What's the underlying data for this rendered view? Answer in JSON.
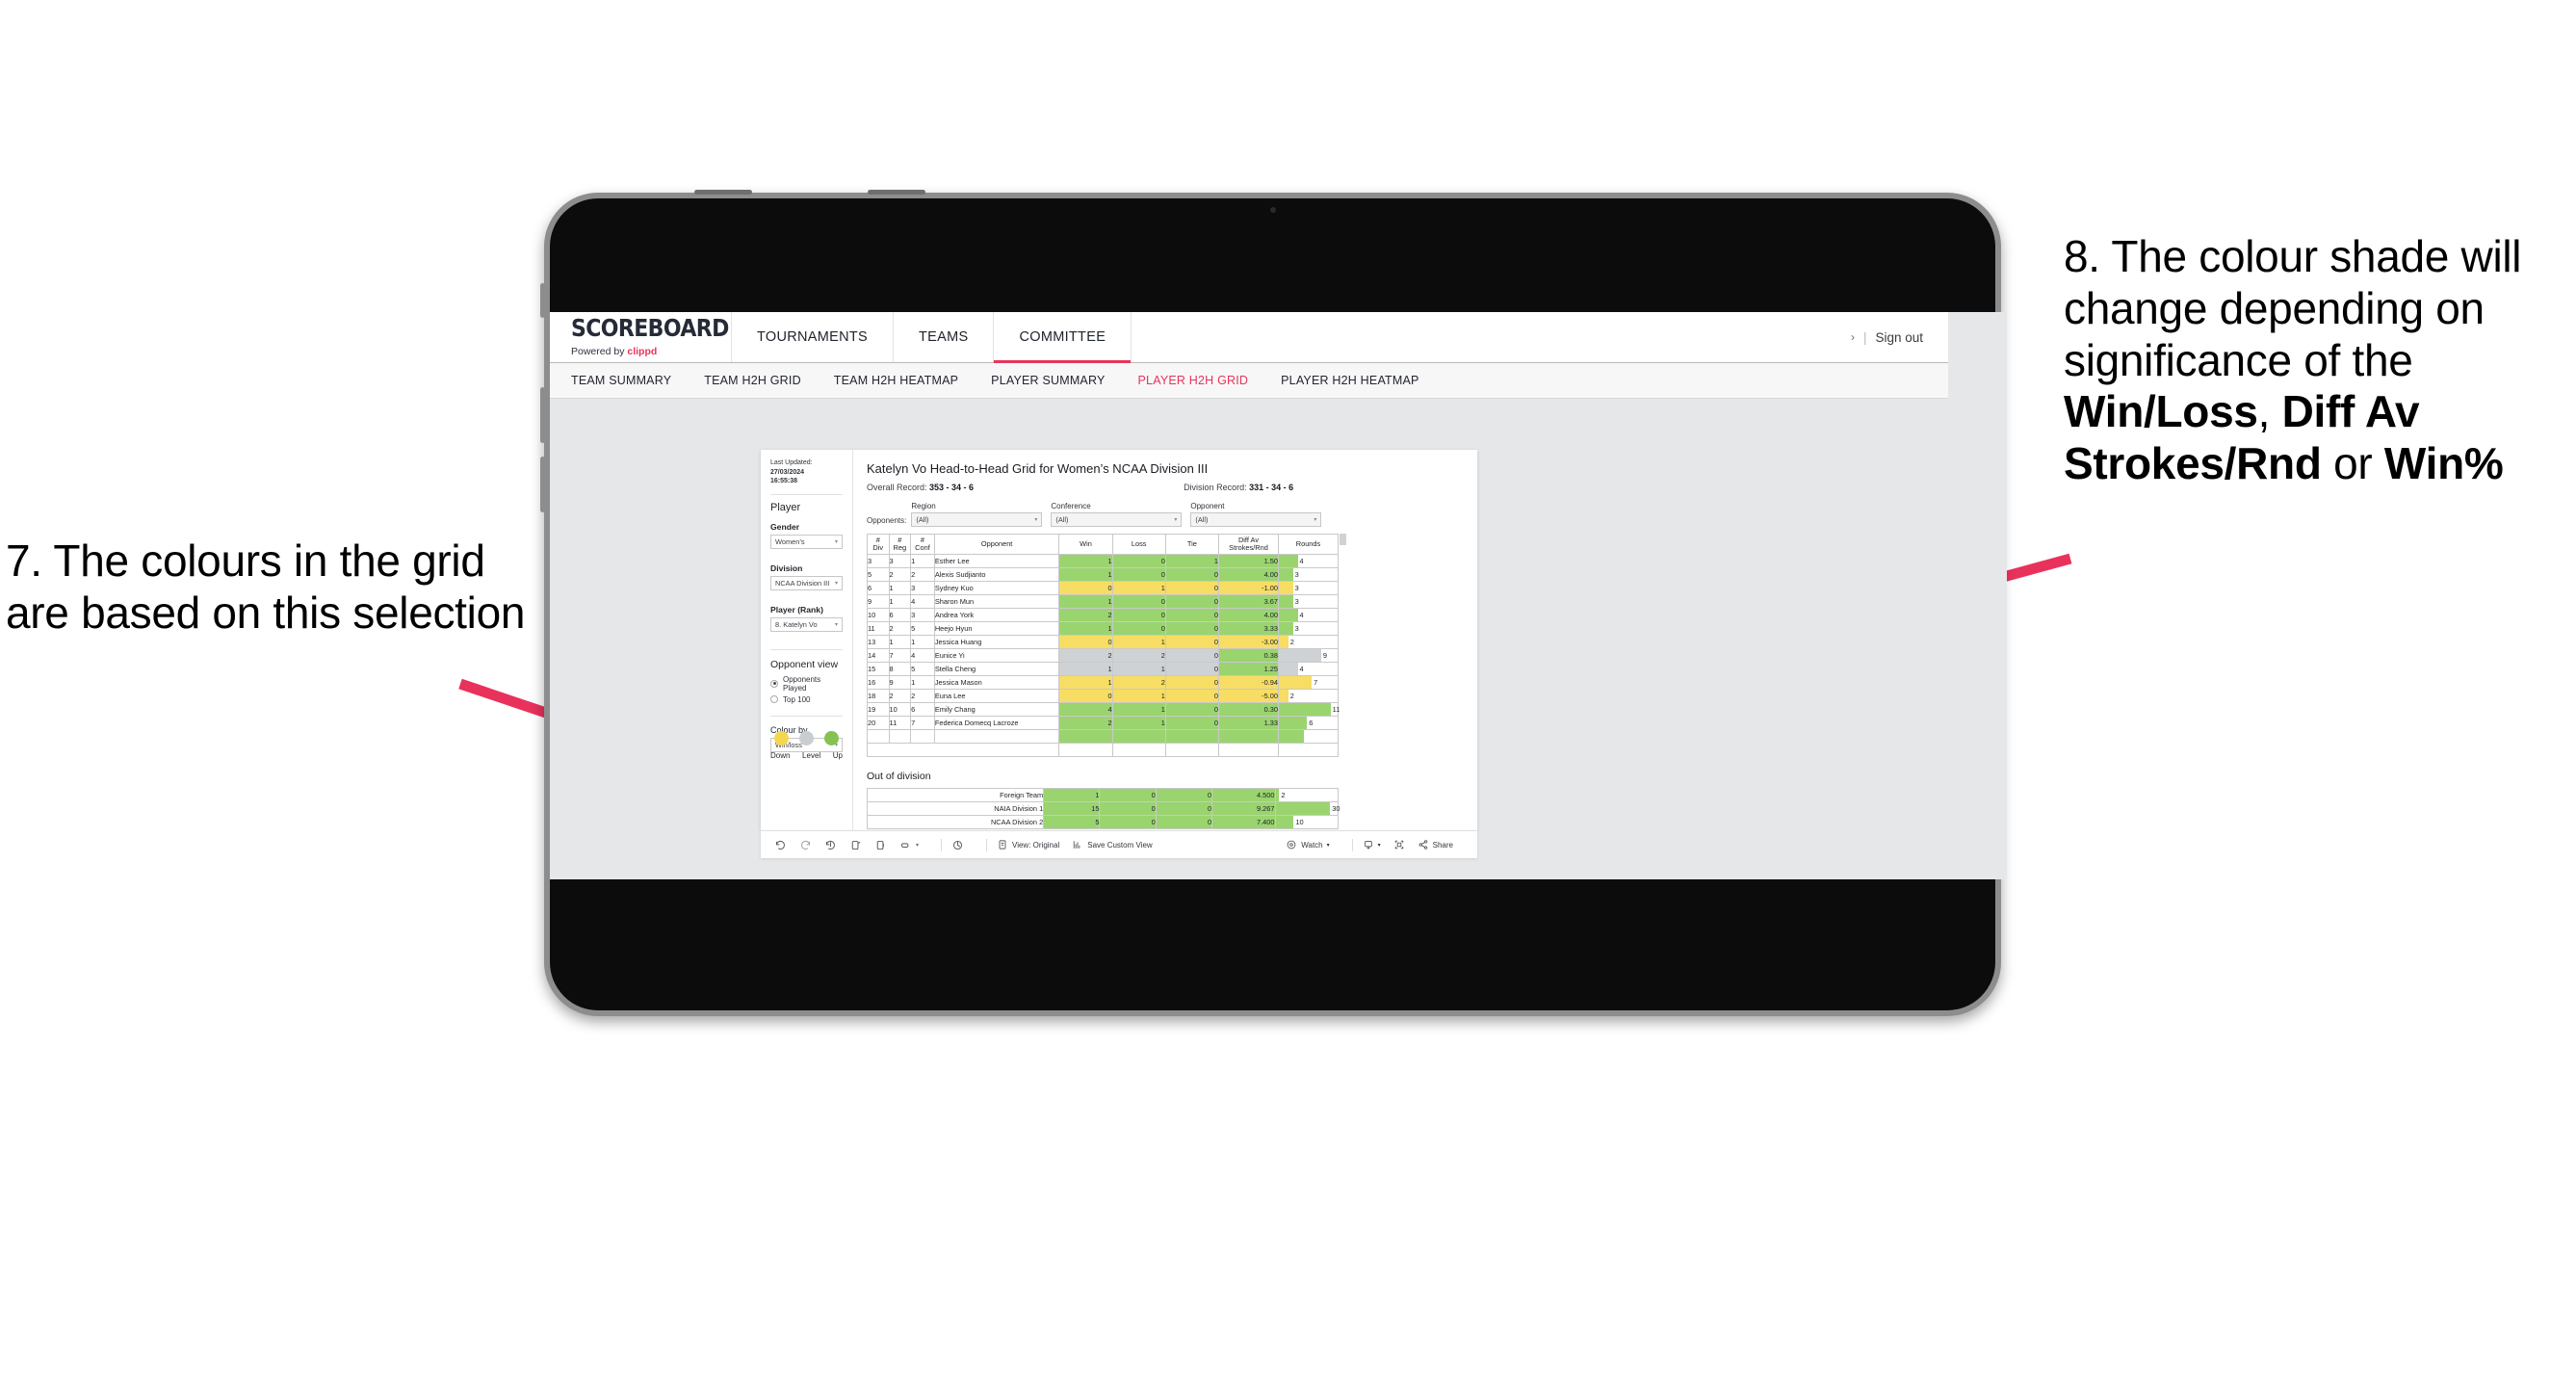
{
  "annotations": {
    "left": {
      "id": "7.",
      "text": "7. The colours in the grid are based on this selection"
    },
    "right": {
      "prefix": "8. The colour shade will change depending on significance of the ",
      "bold1": "Win/Loss",
      "mid1": ", ",
      "bold2": "Diff Av Strokes/Rnd",
      "mid2": " or ",
      "bold3": "Win%"
    },
    "arrow_color": "#e8325c"
  },
  "header": {
    "brand_title": "SCOREBOARD",
    "brand_powered": "Powered by ",
    "brand_name": "clippd",
    "nav": [
      {
        "label": "TOURNAMENTS",
        "active": false
      },
      {
        "label": "TEAMS",
        "active": false
      },
      {
        "label": "COMMITTEE",
        "active": true
      }
    ],
    "chevron": "›",
    "pipe": "|",
    "signout": "Sign out",
    "accent": "#e8345a"
  },
  "subnav": [
    {
      "label": "TEAM SUMMARY",
      "active": false
    },
    {
      "label": "TEAM H2H GRID",
      "active": false
    },
    {
      "label": "TEAM H2H HEATMAP",
      "active": false
    },
    {
      "label": "PLAYER SUMMARY",
      "active": false
    },
    {
      "label": "PLAYER H2H GRID",
      "active": true
    },
    {
      "label": "PLAYER H2H HEATMAP",
      "active": false
    }
  ],
  "sidebar": {
    "last_updated_label": "Last Updated: ",
    "last_updated_date": "27/03/2024",
    "last_updated_time": "16:55:38",
    "player_heading": "Player",
    "gender_label": "Gender",
    "gender_value": "Women’s",
    "division_label": "Division",
    "division_value": "NCAA Division III",
    "player_rank_label": "Player (Rank)",
    "player_rank_value": "8. Katelyn Vo",
    "opponent_view_heading": "Opponent view",
    "opponent_view_options": [
      {
        "label": "Opponents Played",
        "selected": true
      },
      {
        "label": "Top 100",
        "selected": false
      }
    ],
    "colour_by_label": "Colour by",
    "colour_by_value": "Win/loss",
    "legend": [
      {
        "label": "Down",
        "color": "#f3d84e"
      },
      {
        "label": "Level",
        "color": "#c9cdd1"
      },
      {
        "label": "Up",
        "color": "#84c251"
      }
    ]
  },
  "main": {
    "title": "Katelyn Vo Head-to-Head Grid for Women’s NCAA Division III",
    "overall_record_label": "Overall Record: ",
    "overall_record_value": "353 -  34 - 6",
    "division_record_label": "Division Record: ",
    "division_record_value": "331 -  34 - 6",
    "opponents_label": "Opponents:",
    "filters": [
      {
        "label": "Region",
        "value": "(All)"
      },
      {
        "label": "Conference",
        "value": "(All)"
      },
      {
        "label": "Opponent",
        "value": "(All)"
      }
    ],
    "out_of_division_title": "Out of division"
  },
  "chart_data": {
    "type": "table",
    "title": "Katelyn Vo Head-to-Head Grid for Women’s NCAA Division III",
    "columns": [
      "# Div",
      "# Reg",
      "# Conf",
      "Opponent",
      "Win",
      "Loss",
      "Tie",
      "Diff Av Strokes/Rnd",
      "Rounds"
    ],
    "column_headers_lines": [
      [
        "#",
        "Div"
      ],
      [
        "#",
        "Reg"
      ],
      [
        "#",
        "Conf"
      ],
      [
        "Opponent"
      ],
      [
        "Win"
      ],
      [
        "Loss"
      ],
      [
        "Tie"
      ],
      [
        "Diff Av",
        "Strokes/Rnd"
      ],
      [
        "Rounds"
      ]
    ],
    "colors": {
      "up": "#9ad46f",
      "down": "#f7dd63",
      "level": "#cfd2d4",
      "none": "#ffffff"
    },
    "rounds_max": 11,
    "rows": [
      {
        "div": "3",
        "reg": "3",
        "conf": "1",
        "opponent": "Esther Lee",
        "win": "1",
        "loss": "0",
        "tie": "1",
        "diff": "1.50",
        "rounds": 4,
        "state": "up"
      },
      {
        "div": "5",
        "reg": "2",
        "conf": "2",
        "opponent": "Alexis Sudjianto",
        "win": "1",
        "loss": "0",
        "tie": "0",
        "diff": "4.00",
        "rounds": 3,
        "state": "up"
      },
      {
        "div": "6",
        "reg": "1",
        "conf": "3",
        "opponent": "Sydney Kuo",
        "win": "0",
        "loss": "1",
        "tie": "0",
        "diff": "-1.00",
        "rounds": 3,
        "state": "down"
      },
      {
        "div": "9",
        "reg": "1",
        "conf": "4",
        "opponent": "Sharon Mun",
        "win": "1",
        "loss": "0",
        "tie": "0",
        "diff": "3.67",
        "rounds": 3,
        "state": "up"
      },
      {
        "div": "10",
        "reg": "6",
        "conf": "3",
        "opponent": "Andrea York",
        "win": "2",
        "loss": "0",
        "tie": "0",
        "diff": "4.00",
        "rounds": 4,
        "state": "up"
      },
      {
        "div": "11",
        "reg": "2",
        "conf": "5",
        "opponent": "Heejo Hyun",
        "win": "1",
        "loss": "0",
        "tie": "0",
        "diff": "3.33",
        "rounds": 3,
        "state": "up"
      },
      {
        "div": "13",
        "reg": "1",
        "conf": "1",
        "opponent": "Jessica Huang",
        "win": "0",
        "loss": "1",
        "tie": "0",
        "diff": "-3.00",
        "rounds": 2,
        "state": "down"
      },
      {
        "div": "14",
        "reg": "7",
        "conf": "4",
        "opponent": "Eunice Yi",
        "win": "2",
        "loss": "2",
        "tie": "0",
        "diff": "0.38",
        "rounds": 9,
        "state": "level",
        "diff_state": "up"
      },
      {
        "div": "15",
        "reg": "8",
        "conf": "5",
        "opponent": "Stella Cheng",
        "win": "1",
        "loss": "1",
        "tie": "0",
        "diff": "1.25",
        "rounds": 4,
        "state": "level",
        "diff_state": "up"
      },
      {
        "div": "16",
        "reg": "9",
        "conf": "1",
        "opponent": "Jessica Mason",
        "win": "1",
        "loss": "2",
        "tie": "0",
        "diff": "-0.94",
        "rounds": 7,
        "state": "down"
      },
      {
        "div": "18",
        "reg": "2",
        "conf": "2",
        "opponent": "Euna Lee",
        "win": "0",
        "loss": "1",
        "tie": "0",
        "diff": "-5.00",
        "rounds": 2,
        "state": "down"
      },
      {
        "div": "19",
        "reg": "10",
        "conf": "6",
        "opponent": "Emily Chang",
        "win": "4",
        "loss": "1",
        "tie": "0",
        "diff": "0.30",
        "rounds": 11,
        "state": "up"
      },
      {
        "div": "20",
        "reg": "11",
        "conf": "7",
        "opponent": "Federica Domecq Lacroze",
        "win": "2",
        "loss": "1",
        "tie": "0",
        "diff": "1.33",
        "rounds": 6,
        "state": "up"
      }
    ],
    "out_of_division": {
      "rounds_max": 30,
      "rows": [
        {
          "name": "Foreign Team",
          "win": "1",
          "loss": "0",
          "tie": "0",
          "diff": "4.500",
          "rounds": 2,
          "state": "up"
        },
        {
          "name": "NAIA Division 1",
          "win": "15",
          "loss": "0",
          "tie": "0",
          "diff": "9.267",
          "rounds": 30,
          "state": "up"
        },
        {
          "name": "NCAA Division 2",
          "win": "5",
          "loss": "0",
          "tie": "0",
          "diff": "7.400",
          "rounds": 10,
          "state": "up"
        }
      ]
    }
  },
  "toolbar": {
    "view_label": "View: Original",
    "save_label": "Save Custom View",
    "watch_label": "Watch",
    "share_label": "Share",
    "caret": "▾"
  }
}
